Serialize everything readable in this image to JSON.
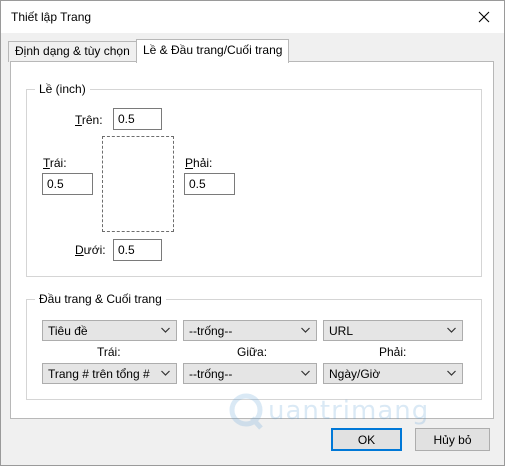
{
  "window": {
    "title": "Thiết lập Trang"
  },
  "tabs": [
    {
      "label": "Định dạng & tùy chọn",
      "active": false
    },
    {
      "label": "Lề & Đầu trang/Cuối trang",
      "active": true
    }
  ],
  "margins": {
    "group_title": "Lề (inch)",
    "top": {
      "label_key": "T",
      "label_rest": "rên:",
      "value": "0.5"
    },
    "left": {
      "label_key": "T",
      "label_rest": "rái:",
      "value": "0.5"
    },
    "right": {
      "label_key": "P",
      "label_rest": "hải:",
      "value": "0.5"
    },
    "bottom": {
      "label_key": "D",
      "label_rest": "ưới:",
      "value": "0.5"
    }
  },
  "header_footer": {
    "group_title": "Đầu trang & Cuối trang",
    "header_left": "Tiêu đề",
    "header_center": "--trống--",
    "header_right": "URL",
    "label_left": "Trái:",
    "label_center": "Giữa:",
    "label_right": "Phải:",
    "footer_left": "Trang # trên tổng #",
    "footer_center": "--trống--",
    "footer_right": "Ngày/Giờ"
  },
  "buttons": {
    "ok": "OK",
    "cancel": "Hủy bỏ"
  },
  "watermark": {
    "text": "uantrimang"
  },
  "icons": {
    "close": "close-icon",
    "dropdown": "chevron-down-icon"
  }
}
